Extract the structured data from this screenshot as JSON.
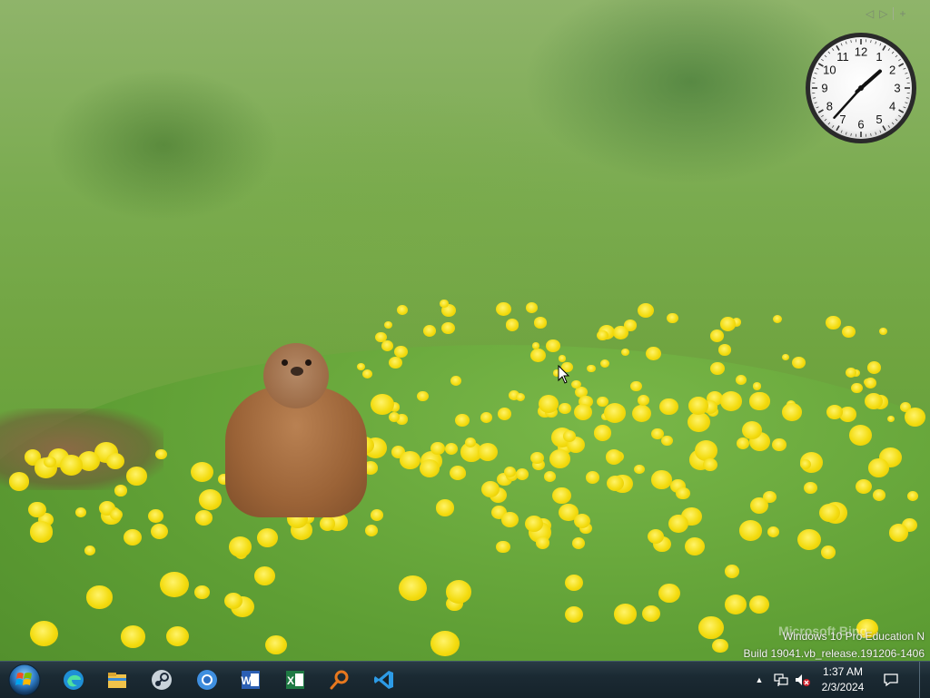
{
  "gadget_controls": {
    "prev": "◁",
    "next": "▷",
    "add": "+"
  },
  "clock_gadget": {
    "numbers": [
      "12",
      "1",
      "2",
      "3",
      "4",
      "5",
      "6",
      "7",
      "8",
      "9",
      "10",
      "11"
    ],
    "time": {
      "hour": 1,
      "minute": 37
    }
  },
  "watermark": {
    "bing_text": "Microsoft Bing",
    "edition": "Windows 10 Pro Education N",
    "build": "Build 19041.vb_release.191206-1406"
  },
  "taskbar": {
    "apps": [
      {
        "name": "edge-icon",
        "color": "#1f8fd6"
      },
      {
        "name": "file-explorer-icon",
        "color": "#f0c24a"
      },
      {
        "name": "steam-icon",
        "color": "#c9d3da"
      },
      {
        "name": "chrome-icon",
        "color": "#3f8fe0"
      },
      {
        "name": "word-icon",
        "color": "#2b5fb4"
      },
      {
        "name": "excel-icon",
        "color": "#1f7a44"
      },
      {
        "name": "search-tool-icon",
        "color": "#e8781e"
      },
      {
        "name": "vscode-icon",
        "color": "#2d9be6"
      }
    ],
    "tray": {
      "overflow_chevron": "▲",
      "clock_time": "1:37 AM",
      "clock_date": "2/3/2024"
    }
  },
  "colors": {
    "taskbar": "#1b2a33",
    "flower": "#f3dc10",
    "grass": "#63a13a"
  }
}
